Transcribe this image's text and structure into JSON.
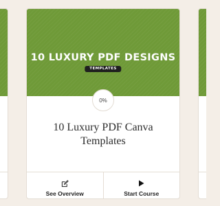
{
  "course": {
    "banner_title": "10 LUXURY PDF DESIGNS",
    "banner_tag": "TEMPLATES",
    "progress_label": "0%",
    "title": "10 Luxury PDF Canva Templates"
  },
  "actions": {
    "overview_label": "See Overview",
    "overview_icon": "edit-icon",
    "start_label": "Start Course",
    "start_icon": "play-icon"
  },
  "colors": {
    "banner": "#6f9a38",
    "page_background": "#f4eee7"
  }
}
